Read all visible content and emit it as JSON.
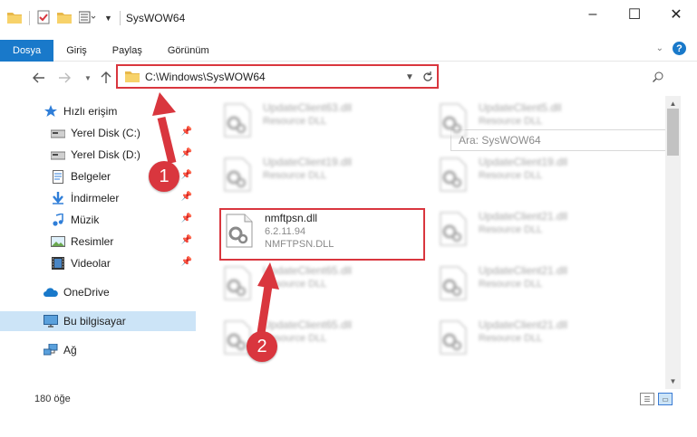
{
  "window": {
    "title": "SysWOW64",
    "minimize": "–",
    "maximize": "☐",
    "close": "✕"
  },
  "ribbon": {
    "tabs": [
      "Dosya",
      "Giriş",
      "Paylaş",
      "Görünüm"
    ],
    "active_tab": "Dosya",
    "help": "?"
  },
  "nav": {
    "address": "C:\\Windows\\SysWOW64",
    "search_placeholder": "Ara: SysWOW64"
  },
  "sidebar": {
    "items": [
      {
        "label": "Hızlı erişim",
        "icon": "star-icon"
      },
      {
        "label": "Yerel Disk (C:)",
        "icon": "drive-icon",
        "pinned": true
      },
      {
        "label": "Yerel Disk (D:)",
        "icon": "drive-icon",
        "pinned": true
      },
      {
        "label": "Belgeler",
        "icon": "documents-icon",
        "pinned": true
      },
      {
        "label": "İndirmeler",
        "icon": "download-icon",
        "pinned": true
      },
      {
        "label": "Müzik",
        "icon": "music-icon",
        "pinned": true
      },
      {
        "label": "Resimler",
        "icon": "pictures-icon",
        "pinned": true
      },
      {
        "label": "Videolar",
        "icon": "videos-icon",
        "pinned": true
      },
      {
        "label": "OneDrive",
        "icon": "onedrive-icon"
      },
      {
        "label": "Bu bilgisayar",
        "icon": "computer-icon",
        "selected": true
      },
      {
        "label": "Ağ",
        "icon": "network-icon"
      }
    ]
  },
  "files": [
    {
      "name": "UpdateClient63.dll",
      "line1": "Resource DLL",
      "line2": ""
    },
    {
      "name": "UpdateClient5.dll",
      "line1": "Resource DLL",
      "line2": ""
    },
    {
      "name": "UpdateClient19.dll",
      "line1": "Resource DLL",
      "line2": ""
    },
    {
      "name": "UpdateClient19.dll",
      "line1": "Resource DLL",
      "line2": ""
    },
    {
      "name": "nmftpsn.dll",
      "line1": "6.2.11.94",
      "line2": "NMFTPSN.DLL"
    },
    {
      "name": "UpdateClient21.dll",
      "line1": "Resource DLL",
      "line2": ""
    },
    {
      "name": "UpdateClient65.dll",
      "line1": "Resource DLL",
      "line2": ""
    },
    {
      "name": "UpdateClient21.dll",
      "line1": "Resource DLL",
      "line2": ""
    },
    {
      "name": "UpdateClient65.dll",
      "line1": "Resource DLL",
      "line2": ""
    },
    {
      "name": "UpdateClient21.dll",
      "line1": "Resource DLL",
      "line2": ""
    }
  ],
  "status": {
    "item_count": "180 öğe"
  },
  "annotations": {
    "step1": "1",
    "step2": "2"
  },
  "colors": {
    "accent": "#1979ca",
    "highlight_red": "#d9363e",
    "selected_bg": "#cce4f7"
  }
}
